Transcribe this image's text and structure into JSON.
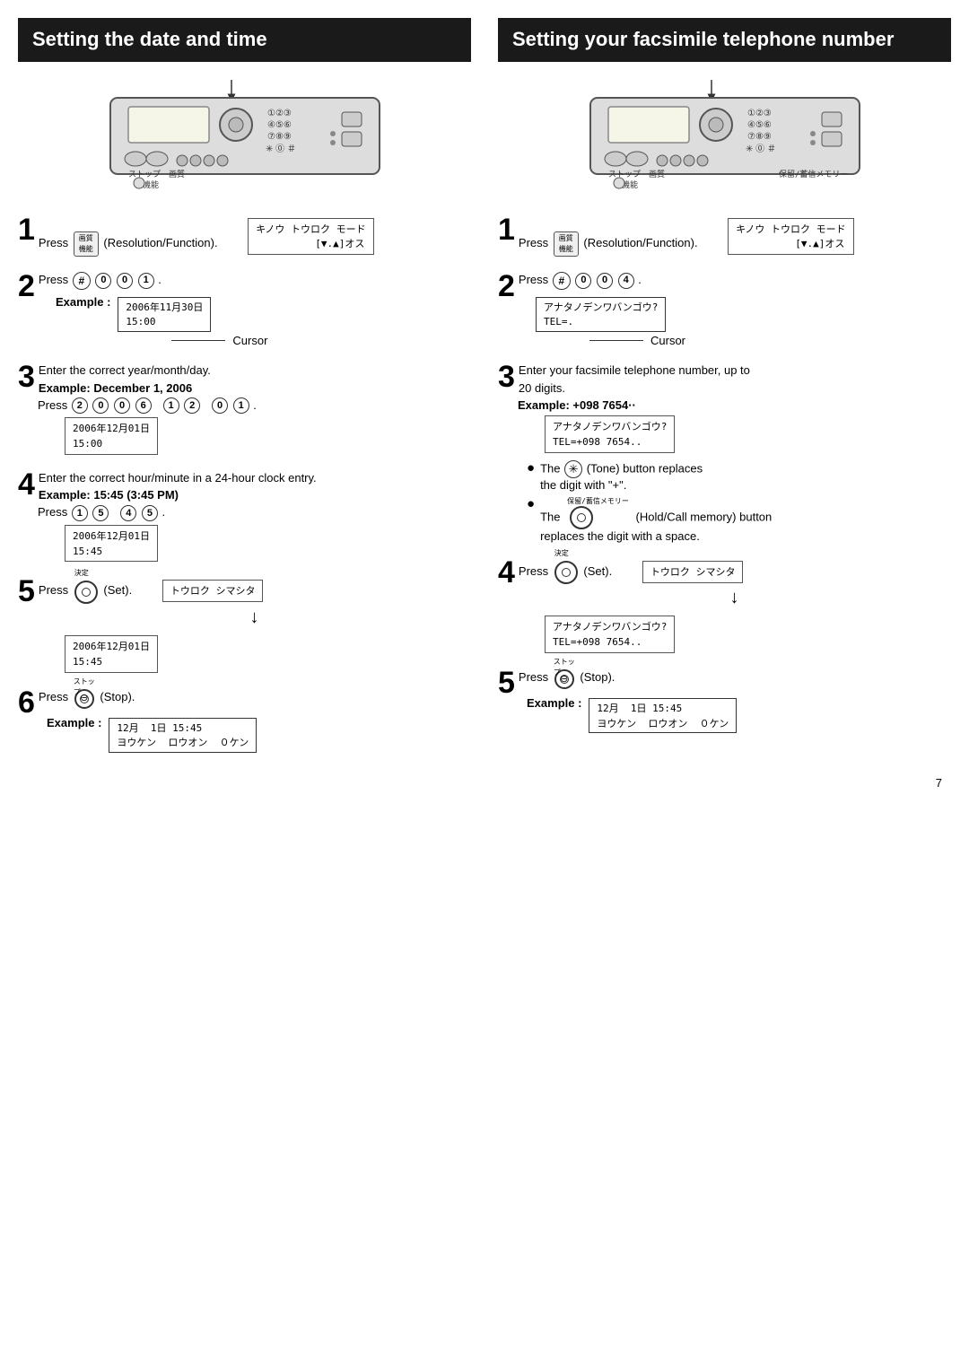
{
  "left_section": {
    "title": "Setting the date and time",
    "step1": {
      "number": "1",
      "text": "Press",
      "btn_label": "画質\n機能",
      "suffix": "(Resolution/Function).",
      "display": "キノウ トウロク モード\n　　　　　　[▼.▲]オス"
    },
    "step2": {
      "number": "2",
      "text": "Press",
      "buttons": [
        "#",
        "0",
        "0",
        "1"
      ],
      "example_label": "Example :",
      "example_line1": "2006年11月30日",
      "example_line2": "15:00",
      "cursor_label": "Cursor"
    },
    "step3": {
      "number": "3",
      "text": "Enter the correct year/month/day.",
      "bold1": "Example: December 1, 2006",
      "bold2": "Press",
      "press_seq": "２００６　１２　０１",
      "display_line1": "2006年12月01日",
      "display_line2": "15:00"
    },
    "step4": {
      "number": "4",
      "text": "Enter the correct hour/minute in a 24-hour clock entry.",
      "bold1": "Example: 15:45 (3:45 PM)",
      "bold2": "Press",
      "press_seq": "１５　４５",
      "display_line1": "2006年12月01日",
      "display_line2": "15:45"
    },
    "step5": {
      "number": "5",
      "text": "Press",
      "label_furigana": "決定",
      "suffix": "(Set).",
      "display_line1": "トウロク シマシタ",
      "arrow": "↓",
      "display2_line1": "2006年12月01日",
      "display2_line2": "15:45"
    },
    "step6": {
      "number": "6",
      "text": "Press",
      "label_furigana": "ストップ",
      "suffix": "(Stop).",
      "example_label": "Example :",
      "example_line1": "12月  1日 15:45",
      "example_line2": "ヨウケン  ロウオン  ０ケン"
    }
  },
  "right_section": {
    "title": "Setting your facsimile telephone number",
    "step1": {
      "number": "1",
      "text": "Press",
      "btn_label": "画質\n機能",
      "suffix": "(Resolution/Function).",
      "display": "キノウ トウロク モード\n　　　　　　[▼.▲]オス"
    },
    "step2": {
      "number": "2",
      "text": "Press",
      "buttons": [
        "#",
        "0",
        "0",
        "4"
      ],
      "display_line1": "アナタノデンワバンゴウ?",
      "display_line2": "TEL=.",
      "cursor_label": "Cursor"
    },
    "step3": {
      "number": "3",
      "text": "Enter your facsimile telephone number, up to",
      "text2": "20 digits.",
      "bold1": "Example: +098 7654··",
      "display_line1": "アナタノデンワバンゴウ?",
      "display_line2": "TEL=+098 7654..",
      "bullet1_part1": "The",
      "bullet1_star": "✳",
      "bullet1_part2": "(Tone) button replaces",
      "bullet1_part3": "the digit with \"+\".",
      "bullet2_part1": "The",
      "bullet2_label": "保留/蓄信メモリー",
      "bullet2_part2": "(Hold/Call memory) button",
      "bullet2_part3": "replaces the digit with a space."
    },
    "step4": {
      "number": "4",
      "text": "Press",
      "label_furigana": "決定",
      "suffix": "(Set).",
      "display_line1": "トウロク シマシタ",
      "arrow": "↓",
      "display2_line1": "アナタノデンワバンゴウ?",
      "display2_line2": "TEL=+098 7654.."
    },
    "step5": {
      "number": "5",
      "text": "Press",
      "label_furigana": "ストップ",
      "suffix": "(Stop).",
      "example_label": "Example :",
      "example_line1": "12月  1日 15:45",
      "example_line2": "ヨウケン  ロウオン  ０ケン"
    }
  },
  "page_number": "7"
}
